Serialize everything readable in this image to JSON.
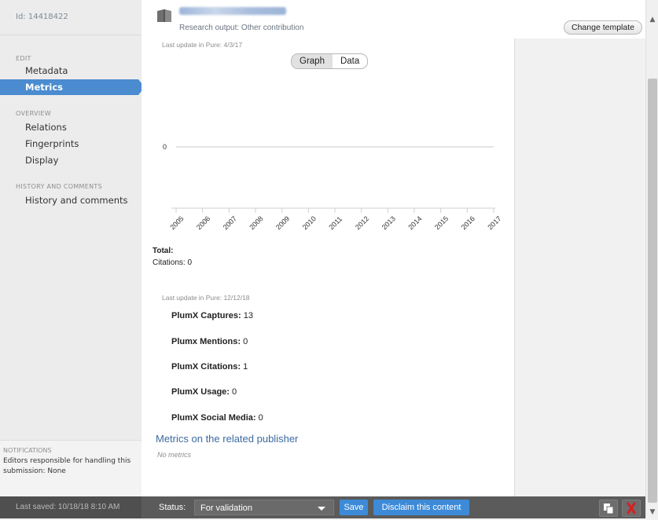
{
  "sidebar": {
    "id_line": "Id: 14418422",
    "sections": [
      {
        "title": "EDIT",
        "items": [
          {
            "label": "Metadata"
          },
          {
            "label": "Metrics",
            "active": true
          }
        ]
      },
      {
        "title": "OVERVIEW",
        "items": [
          {
            "label": "Relations"
          },
          {
            "label": "Fingerprints"
          },
          {
            "label": "Display"
          }
        ]
      },
      {
        "title": "HISTORY AND COMMENTS",
        "items": [
          {
            "label": "History and comments"
          }
        ]
      }
    ],
    "notifications": {
      "title": "NOTIFICATIONS",
      "body": "Editors responsible for handling this submission: None"
    }
  },
  "header": {
    "subtitle": "Research output: Other contribution",
    "change_template": "Change template",
    "icon": "book-icon"
  },
  "main": {
    "last_update_1": "Last update in Pure: 4/3/17",
    "toggle": {
      "graph": "Graph",
      "data": "Data",
      "selected": "Graph"
    },
    "total_label": "Total:",
    "citations_line": "Citations: 0",
    "last_update_2": "Last update in Pure: 12/12/18",
    "plumx": [
      {
        "label": "PlumX Captures:",
        "value": "13"
      },
      {
        "label": "Plumx Mentions:",
        "value": "0"
      },
      {
        "label": "PlumX Citations:",
        "value": "1"
      },
      {
        "label": "PlumX Usage:",
        "value": "0"
      },
      {
        "label": "PlumX Social Media:",
        "value": "0"
      }
    ],
    "related_title": "Metrics on the related publisher",
    "no_metrics": "No metrics"
  },
  "chart_data": {
    "type": "line",
    "x": [
      "2005",
      "2006",
      "2007",
      "2008",
      "2009",
      "2010",
      "2011",
      "2012",
      "2013",
      "2014",
      "2015",
      "2016",
      "2017"
    ],
    "y_tick_labels": [
      "0"
    ],
    "series": [
      {
        "values": [
          0,
          0,
          0,
          0,
          0,
          0,
          0,
          0,
          0,
          0,
          0,
          0,
          0
        ]
      }
    ],
    "line_color": "#d3d3d3"
  },
  "footer": {
    "last_saved": "Last saved: 10/18/18 8:10 AM",
    "status_label": "Status:",
    "status_value": "For validation",
    "save": "Save",
    "disclaim": "Disclaim this content",
    "copy_icon": "copy-icon",
    "delete_icon": "delete-x-icon"
  },
  "colors": {
    "accent": "#4a8ccf",
    "footer": "#5b5b5b",
    "button": "#3d8bd8",
    "delete": "#d62020"
  }
}
